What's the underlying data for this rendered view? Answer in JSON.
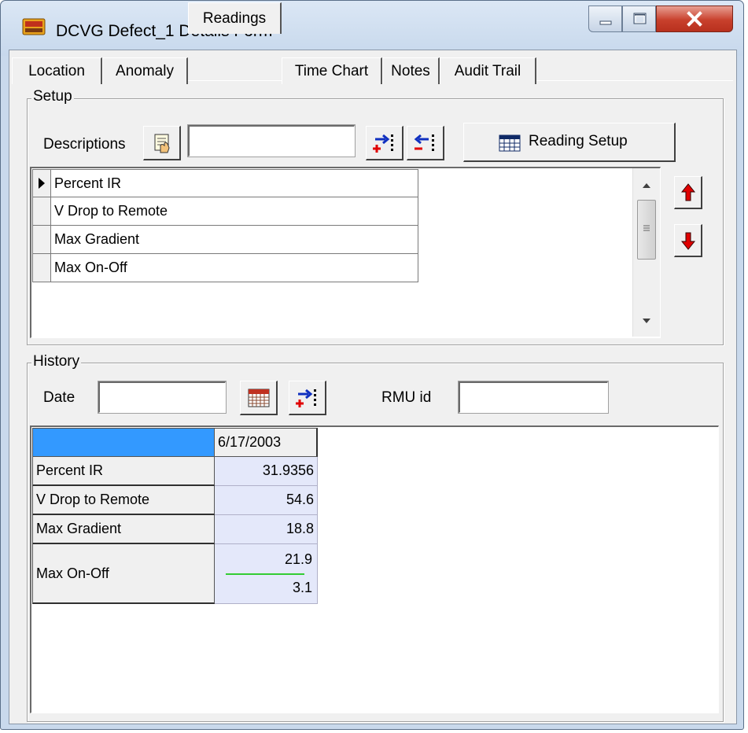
{
  "window": {
    "title": "DCVG Defect_1 Details Form"
  },
  "tabs": [
    {
      "label": "Location",
      "active": false
    },
    {
      "label": "Anomaly",
      "active": false
    },
    {
      "label": "Readings",
      "active": true
    },
    {
      "label": "Time Chart",
      "active": false
    },
    {
      "label": "Notes",
      "active": false
    },
    {
      "label": "Audit Trail",
      "active": false
    }
  ],
  "setup": {
    "group_label": "Setup",
    "descriptions_label": "Descriptions",
    "description_value": "",
    "reading_setup_label": "Reading Setup",
    "readings": [
      "Percent IR",
      "V Drop to Remote",
      "Max Gradient",
      "Max On-Off"
    ]
  },
  "history": {
    "group_label": "History",
    "date_label": "Date",
    "date_value": "",
    "rmu_label": "RMU id",
    "rmu_value": "",
    "column_header": "6/17/2003",
    "rows": [
      {
        "label": "Percent IR",
        "value": "31.9356"
      },
      {
        "label": "V Drop to Remote",
        "value": "54.6"
      },
      {
        "label": "Max Gradient",
        "value": "18.8"
      },
      {
        "label": "Max On-Off",
        "value": "21.9",
        "value2": "3.1"
      }
    ]
  },
  "colors": {
    "header_blue": "#3399ff",
    "value_cell": "#e4e8fa",
    "divider_green": "#33cc33",
    "arrow_red": "#e00000"
  }
}
